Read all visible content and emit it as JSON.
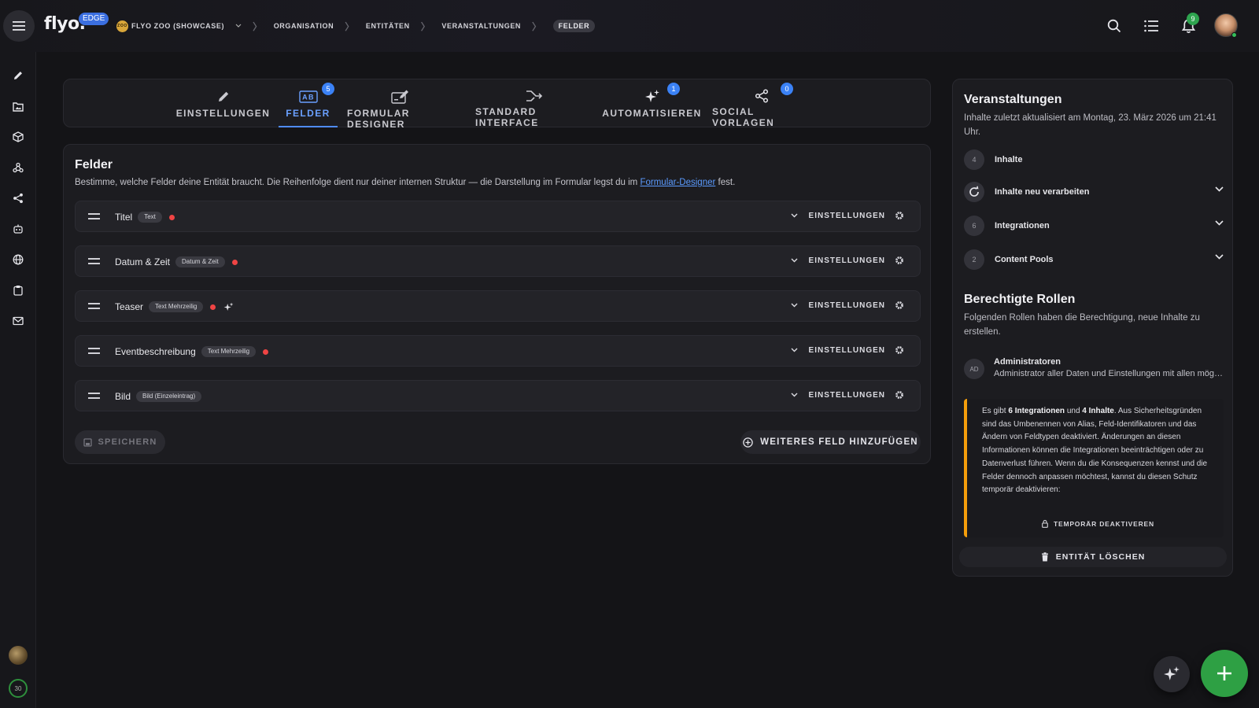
{
  "header": {
    "logo": "flyo.",
    "edge_badge": "EDGE",
    "org_icon_text": "ZOO",
    "breadcrumb": [
      "FLYO ZOO (SHOWCASE)",
      "ORGANISATION",
      "ENTITÄTEN",
      "VERANSTALTUNGEN",
      "FELDER"
    ],
    "notification_count": "9"
  },
  "sidebar": {
    "icons": [
      "pencil-icon",
      "folder-image-icon",
      "cube-icon",
      "webhook-icon",
      "share-icon",
      "robot-icon",
      "globe-icon",
      "clipboard-icon",
      "mail-icon"
    ],
    "ring_value": "30"
  },
  "tabs": [
    {
      "label": "EINSTELLUNGEN",
      "icon": "pencil-icon",
      "badge": null
    },
    {
      "label": "FELDER",
      "icon": "ab-field-icon",
      "badge": "5"
    },
    {
      "label": "FORMULAR DESIGNER",
      "icon": "form-edit-icon",
      "badge": null
    },
    {
      "label": "STANDARD INTERFACE",
      "icon": "merge-arrow-icon",
      "badge": null
    },
    {
      "label": "AUTOMATISIEREN",
      "icon": "sparkle-icon",
      "badge": "1"
    },
    {
      "label": "SOCIAL VORLAGEN",
      "icon": "share-icon",
      "badge": "0"
    }
  ],
  "fields_section": {
    "title": "Felder",
    "description": "Bestimme, welche Felder deine Entität braucht. Die Reihenfolge dient nur deiner internen Struktur — die Darstellung im Formular legst du im",
    "link": "Formular-Designer",
    "description_end": "fest.",
    "rows": [
      {
        "name": "Titel",
        "type": "Text",
        "required": true,
        "ai": false,
        "settings_label": "EINSTELLUNGEN"
      },
      {
        "name": "Datum & Zeit",
        "type": "Datum & Zeit",
        "required": true,
        "ai": false,
        "settings_label": "EINSTELLUNGEN"
      },
      {
        "name": "Teaser",
        "type": "Text Mehrzeilig",
        "required": true,
        "ai": true,
        "settings_label": "EINSTELLUNGEN"
      },
      {
        "name": "Eventbeschreibung",
        "type": "Text Mehrzeilig",
        "required": true,
        "ai": false,
        "settings_label": "EINSTELLUNGEN"
      },
      {
        "name": "Bild",
        "type": "Bild (Einzeleintrag)",
        "required": false,
        "ai": false,
        "settings_label": "EINSTELLUNGEN"
      }
    ],
    "save_label": "SPEICHERN",
    "add_label": "WEITERES FELD HINZUFÜGEN"
  },
  "right_panel": {
    "title": "Veranstaltungen",
    "updated_text": "Inhalte zuletzt aktualisiert am Montag, 23. März 2026 um 21:41 Uhr.",
    "items": [
      {
        "count": "4",
        "label": "Inhalte"
      },
      {
        "count": "",
        "label": "Inhalte neu verarbeiten"
      },
      {
        "count": "6",
        "label": "Integrationen"
      },
      {
        "count": "2",
        "label": "Content Pools"
      }
    ],
    "roles_title": "Berechtigte Rollen",
    "roles_desc": "Folgenden Rollen haben die Berechtigung, neue Inhalte zu erstellen.",
    "role": {
      "initials": "AD",
      "name": "Administratoren",
      "desc": "Administrator aller Daten und Einstellungen mit allen möglichen Rechten"
    },
    "warning": {
      "pre": "Es gibt",
      "bold1": "6 Integrationen",
      "mid": "und",
      "bold2": "4 Inhalte",
      "rest": ". Aus Sicherheitsgründen sind das Umbenennen von Alias, Feld-Identifikatoren und das Ändern von Feldtypen deaktiviert. Änderungen an diesen Informationen können die Integrationen beeinträchtigen oder zu Datenverlust führen. Wenn du die Konsequenzen kennst und die Felder dennoch anpassen möchtest, kannst du diesen Schutz temporär deaktivieren:",
      "button": "TEMPORÄR DEAKTIVEREN"
    },
    "delete_label": "ENTITÄT LÖSCHEN"
  },
  "colors": {
    "accent": "#4f8cff",
    "danger": "#ef4444",
    "warning": "#f59e0b",
    "success": "#2ea044"
  }
}
